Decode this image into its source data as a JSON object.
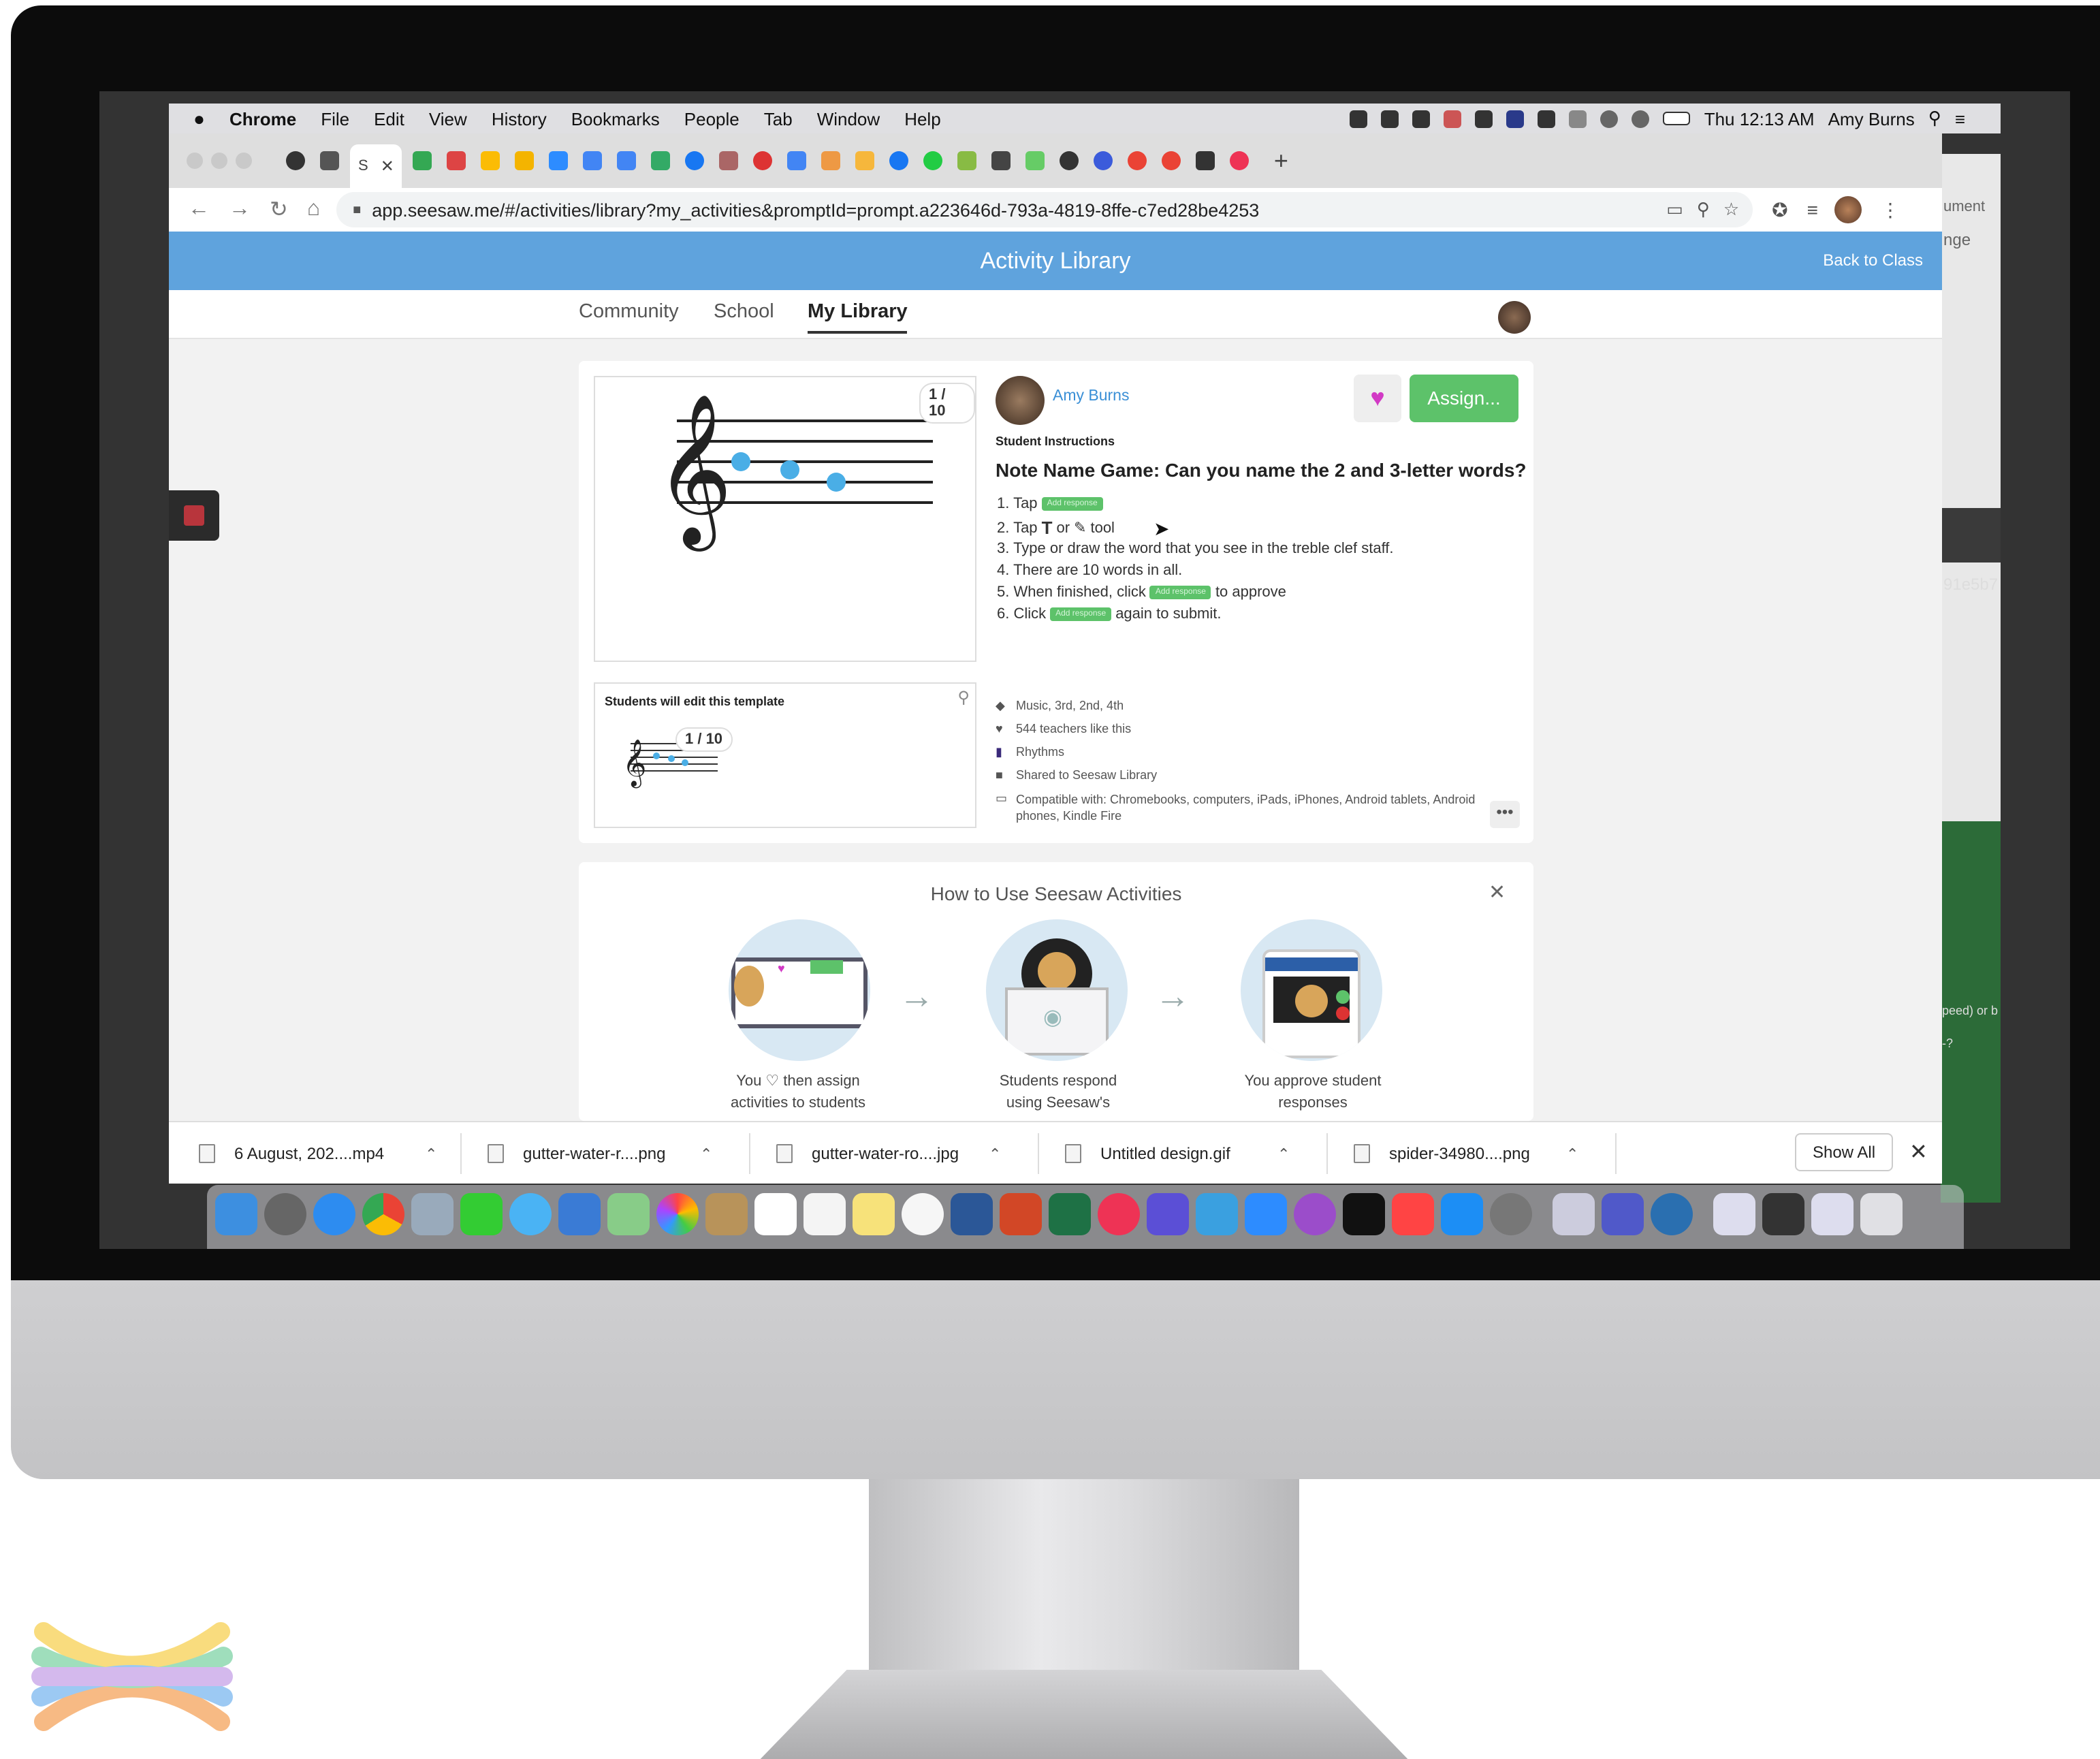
{
  "menubar": {
    "app": "Chrome",
    "items": [
      "File",
      "Edit",
      "View",
      "History",
      "Bookmarks",
      "People",
      "Tab",
      "Window",
      "Help"
    ],
    "clock": "Thu 12:13 AM",
    "user": "Amy Burns"
  },
  "browser": {
    "active_tab_label": "S",
    "url": "app.seesaw.me/#/activities/library?my_activities&promptId=prompt.a223646d-793a-4819-8ffe-c7ed28be4253"
  },
  "seesaw": {
    "header_title": "Activity Library",
    "back_link": "Back to Class",
    "nav": [
      "Community",
      "School",
      "My Library"
    ],
    "activity": {
      "pager": "1 / 10",
      "author": "Amy Burns",
      "assign_label": "Assign...",
      "instructions_label": "Student Instructions",
      "title": "Note Name Game: Can you name the 2 and 3-letter words?",
      "steps": [
        {
          "pre": "1. Tap",
          "pill": "Add response",
          "post": ""
        },
        {
          "pre": "2. Tap",
          "icon1": "T",
          "mid": "or",
          "icon2": "✎",
          "post": "tool"
        },
        {
          "pre": "3. Type or draw the word that you see in the treble clef staff.",
          "post": ""
        },
        {
          "pre": "4. There are 10 words in all.",
          "post": ""
        },
        {
          "pre": "5. When finished, click",
          "pill": "Add response",
          "post": "to approve"
        },
        {
          "pre": "6. Click",
          "pill": "Add response",
          "post": "again to submit."
        }
      ],
      "template_label": "Students will edit this template",
      "template_pager": "1 / 10",
      "meta": {
        "tags": "Music, 3rd, 2nd, 4th",
        "likes": "544 teachers like this",
        "folder": "Rhythms",
        "shared": "Shared to Seesaw Library",
        "compatible_line1": "Compatible with: Chromebooks, computers, iPads, iPhones, Android tablets, Android",
        "compatible_line2": "phones, Kindle Fire"
      },
      "more_label": "•••"
    },
    "howto": {
      "title": "How to Use Seesaw Activities",
      "close": "✕",
      "steps": [
        {
          "line1": "You ♡ then assign",
          "line2": "activities to students"
        },
        {
          "line1": "Students respond",
          "line2": "using Seesaw's"
        },
        {
          "line1": "You approve student",
          "line2": "responses"
        }
      ]
    }
  },
  "downloads": {
    "items": [
      "6 August, 202....mp4",
      "gutter-water-r....png",
      "gutter-water-ro....jpg",
      "Untitled design.gif",
      "spider-34980....png"
    ],
    "show_all": "Show All"
  },
  "background_app": {
    "snippets": [
      "ument",
      "nge",
      "91e5b7",
      "peed) or b",
      "-?"
    ]
  },
  "colors": {
    "seesaw_blue": "#5fa3dd",
    "assign_green": "#5dc26a",
    "heart_pink": "#d23ac5",
    "link_blue": "#3a8fd6"
  }
}
